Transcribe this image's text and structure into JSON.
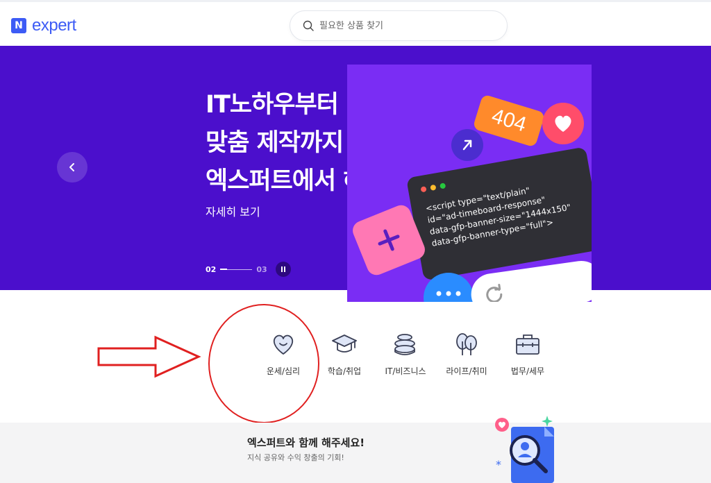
{
  "header": {
    "logo_mark": "N",
    "logo_text": "expert",
    "search_placeholder": "필요한 상품 찾기"
  },
  "banner": {
    "headline_lines": [
      "IT노하우부터",
      "맞춤 제작까지",
      "엑스퍼트에서 해결!"
    ],
    "detail_link": "자세히 보기",
    "pager_current": "02",
    "pager_total": "03",
    "illustration": {
      "tag_text": "404",
      "code_lines": [
        "<script type=\"text/plain\"",
        "id=\"ad-timeboard-response\"",
        "data-gfp-banner-size=\"1444x150\"",
        "data-gfp-banner-type=\"full\">"
      ]
    },
    "colors": {
      "background": "#4b0fcc",
      "illustration_bg": "#7a2df4"
    }
  },
  "categories": [
    {
      "label": "운세/심리",
      "icon": "heart-smile-icon"
    },
    {
      "label": "학습/취업",
      "icon": "graduation-cap-icon"
    },
    {
      "label": "IT/비즈니스",
      "icon": "coins-stack-icon"
    },
    {
      "label": "라이프/취미",
      "icon": "trees-icon"
    },
    {
      "label": "법무/세무",
      "icon": "briefcase-icon"
    }
  ],
  "bottom": {
    "title": "엑스퍼트와 함께 해주세요!",
    "subtitle": "지식 공유와 수익 창출의 기회!"
  }
}
